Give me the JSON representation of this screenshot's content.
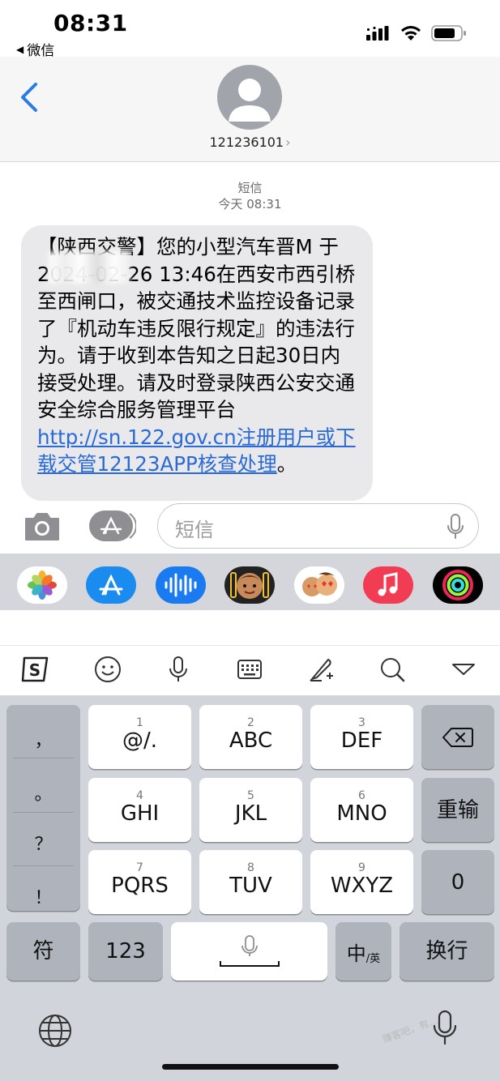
{
  "status_bar": {
    "time": "08:31",
    "back_app": "微信"
  },
  "header": {
    "contact": "121236101"
  },
  "conversation": {
    "service": "短信",
    "timestamp": "今天 08:31",
    "message": {
      "text_before_link": "【陕西交警】您的小型汽车晋M     于2024-02-26 13:46在西安市西引桥至西闸口，被交通技术监控设备记录了『机动车违反限行规定』的违法行为。请于收到本告知之日起30日内接受处理。请及时登录陕西公安交通安全综合服务管理平台 ",
      "link_text": "http://sn.122.gov.cn注册用户或下载交管12123APP核查处理",
      "text_after_link": "。"
    }
  },
  "input": {
    "placeholder": "短信"
  },
  "app_strip": {
    "apps": [
      "photos-icon",
      "appstore-icon",
      "audio-message-icon",
      "memoji-icon",
      "memoji-stickers-icon",
      "music-icon",
      "fitness-icon"
    ]
  },
  "keyboard": {
    "toolbar": [
      "sogou-logo-icon",
      "emoji-icon",
      "microphone-icon",
      "keyboard-icon",
      "handwriting-icon",
      "search-icon",
      "collapse-icon"
    ],
    "punctuation": [
      "，",
      "。",
      "？",
      "！"
    ],
    "keys": {
      "k1": {
        "num": "1",
        "label": "@/."
      },
      "k2": {
        "num": "2",
        "label": "ABC"
      },
      "k3": {
        "num": "3",
        "label": "DEF"
      },
      "k4": {
        "num": "4",
        "label": "GHI"
      },
      "k5": {
        "num": "5",
        "label": "JKL"
      },
      "k6": {
        "num": "6",
        "label": "MNO"
      },
      "k7": {
        "num": "7",
        "label": "PQRS"
      },
      "k8": {
        "num": "8",
        "label": "TUV"
      },
      "k9": {
        "num": "9",
        "label": "WXYZ"
      }
    },
    "reenter": "重输",
    "zero": "0",
    "symbols": "符",
    "numbers": "123",
    "lang_main": "中",
    "lang_sub": "/英",
    "enter": "换行"
  },
  "watermark": "赚客吧，有…"
}
